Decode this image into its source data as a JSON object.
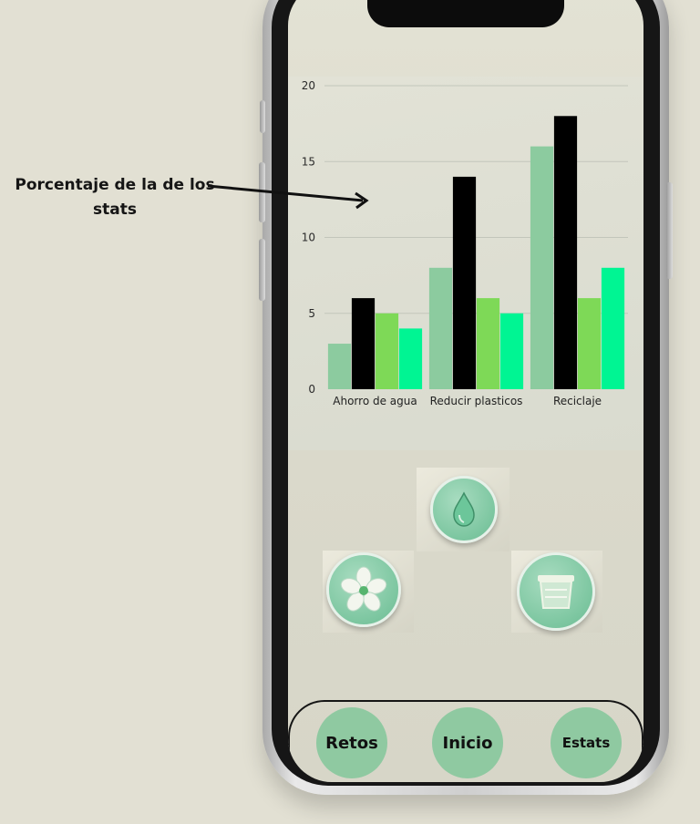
{
  "annotation": {
    "text": "Porcentaje de la de los stats"
  },
  "colors": {
    "series_a": "#8ccb9f",
    "series_b": "#000000",
    "series_c": "#7ed957",
    "series_d": "#00f593"
  },
  "chart_data": {
    "type": "bar",
    "categories": [
      "Ahorro de agua",
      "Reducir plasticos",
      "Reciclaje"
    ],
    "series": [
      {
        "values": [
          3,
          8,
          16
        ]
      },
      {
        "values": [
          6,
          14,
          18
        ]
      },
      {
        "values": [
          5,
          6,
          6
        ]
      },
      {
        "values": [
          4,
          5,
          8
        ]
      }
    ],
    "ylim": [
      0,
      20
    ],
    "yticks": [
      0,
      5,
      10,
      15,
      20
    ],
    "grid": true
  },
  "icons": [
    {
      "name": "water-drop-icon"
    },
    {
      "name": "flower-icon"
    },
    {
      "name": "recycle-bin-icon"
    }
  ],
  "nav": {
    "retos": "Retos",
    "inicio": "Inicio",
    "estats": "Estats"
  }
}
